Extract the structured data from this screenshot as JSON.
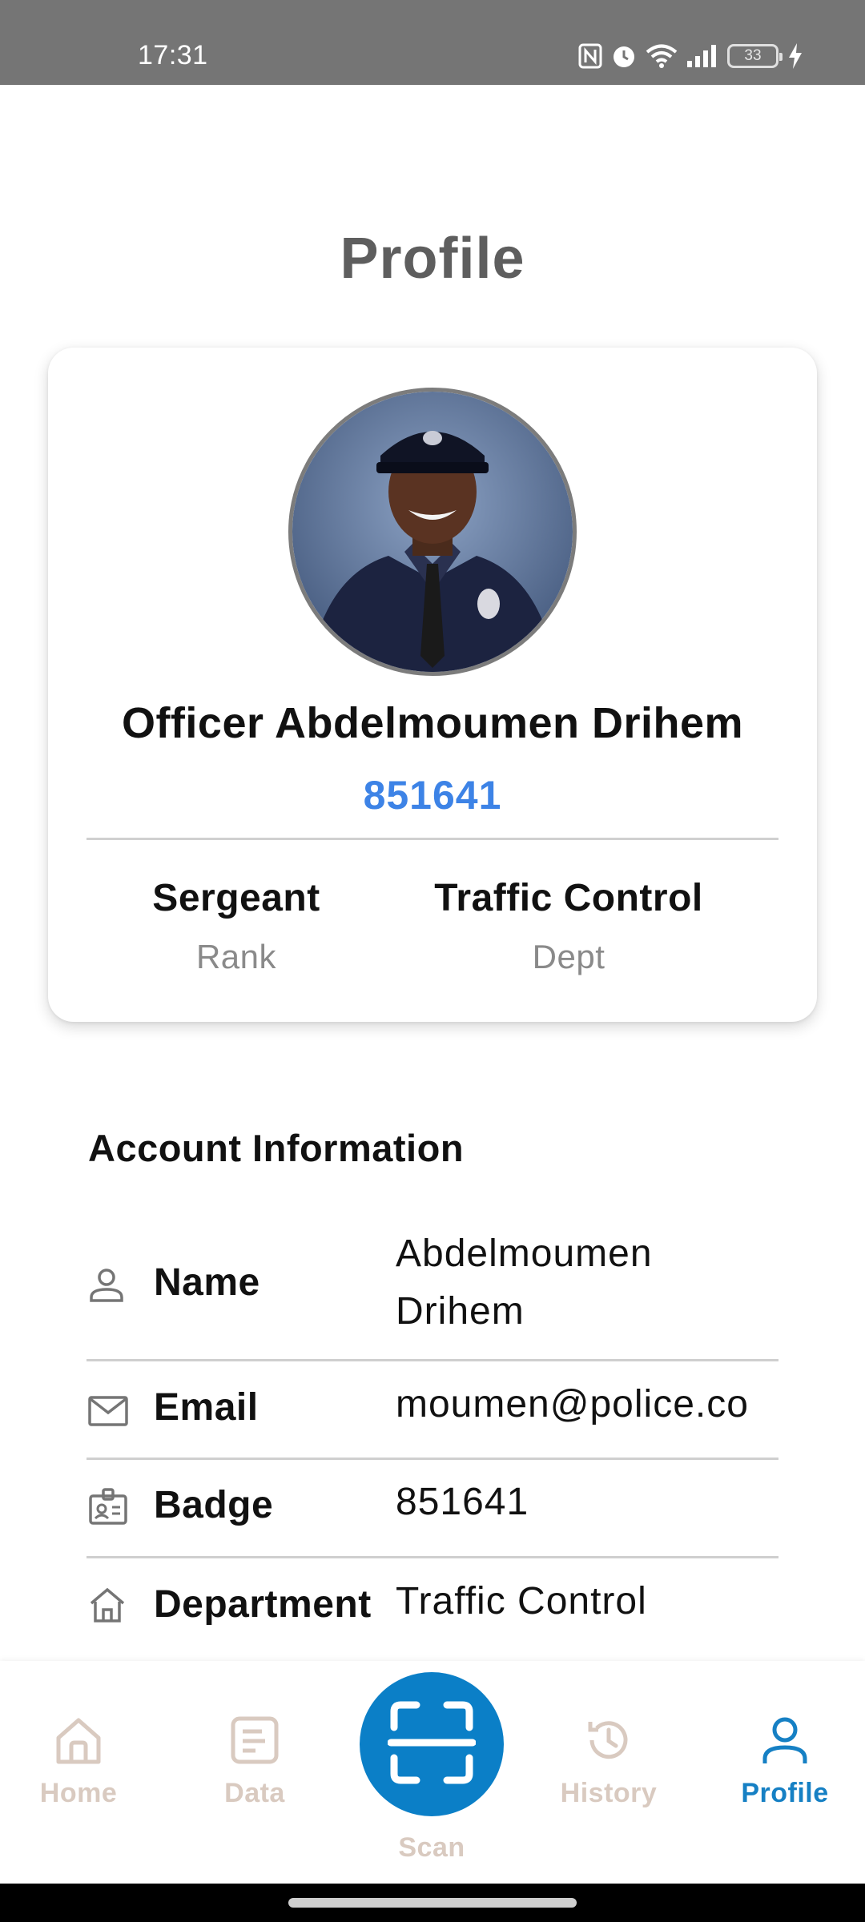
{
  "status_bar": {
    "time": "17:31",
    "battery": "33",
    "icons": [
      "nfc-icon",
      "alarm-icon",
      "wifi-icon",
      "signal-icon",
      "battery-icon",
      "charging-icon"
    ]
  },
  "page": {
    "title": "Profile"
  },
  "profile": {
    "name": "Officer Abdelmoumen Drihem",
    "badge": "851641",
    "rank_value": "Sergeant",
    "rank_label": "Rank",
    "dept_value": "Traffic Control",
    "dept_label": "Dept"
  },
  "account": {
    "section_title": "Account Information",
    "rows": [
      {
        "label": "Name",
        "value": "Abdelmoumen Drihem",
        "icon": "person-icon"
      },
      {
        "label": "Email",
        "value": "moumen@police.co",
        "icon": "mail-icon"
      },
      {
        "label": "Badge",
        "value": "851641",
        "icon": "badge-icon"
      },
      {
        "label": "Department",
        "value": "Traffic Control",
        "icon": "building-icon"
      }
    ]
  },
  "bottom_nav": {
    "items": [
      {
        "label": "Home",
        "icon": "home-icon"
      },
      {
        "label": "Data",
        "icon": "document-icon"
      },
      {
        "label": "Scan",
        "icon": "scan-icon"
      },
      {
        "label": "History",
        "icon": "history-icon"
      },
      {
        "label": "Profile",
        "icon": "person-icon"
      }
    ],
    "active": "Profile"
  },
  "colors": {
    "accent": "#0b7fc7",
    "badge_blue": "#3d83e6",
    "nav_inactive": "#d9cac0",
    "title_gray": "#5e5e5e"
  }
}
